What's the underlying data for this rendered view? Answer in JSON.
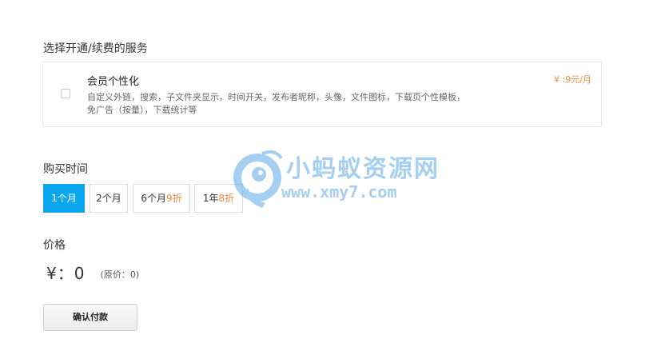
{
  "service_section": {
    "title": "选择开通/续费的服务",
    "items": [
      {
        "name": "会员个性化",
        "description": "自定义外链，搜索，子文件夹显示，时间开关，发布者昵称，头像，文件图标，下载页个性模板，免广告（按量），下载统计等",
        "price": "¥ :9元/月",
        "checked": false
      }
    ]
  },
  "duration_section": {
    "title": "购买时间",
    "options": [
      {
        "label": "1个月",
        "discount": "",
        "active": true
      },
      {
        "label": "2个月",
        "discount": "",
        "active": false
      },
      {
        "label": "6个月",
        "discount": "9折",
        "active": false
      },
      {
        "label": "1年",
        "discount": "8折",
        "active": false
      }
    ]
  },
  "price_section": {
    "title": "价格",
    "amount": "¥：0",
    "original": "(原价：0)"
  },
  "confirm_button": "确认付款",
  "watermark": {
    "brand_cn": "小蚂蚁资源网",
    "url": "www.xmy7.com"
  },
  "colors": {
    "accent": "#0aa6ef",
    "discount": "#f0883a",
    "watermark": "#5aa9e6"
  }
}
